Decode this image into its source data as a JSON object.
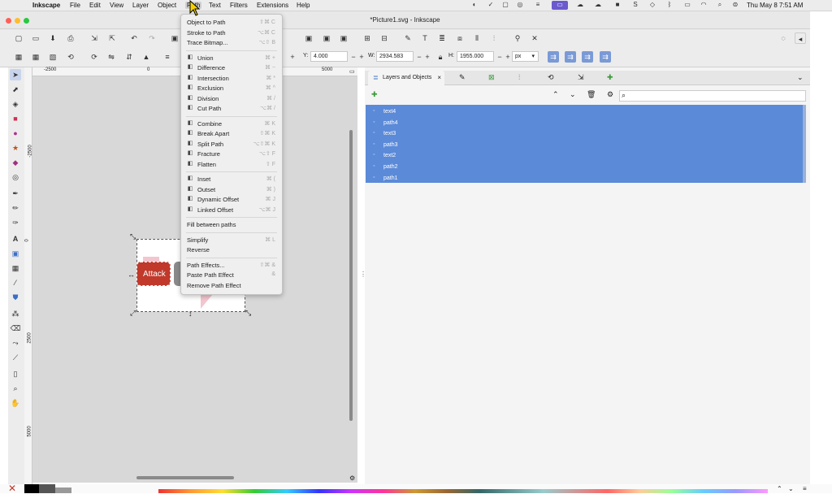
{
  "system_menubar": {
    "app": "Inkscape",
    "menus": [
      "File",
      "Edit",
      "View",
      "Layer",
      "Object",
      "Path",
      "Text",
      "Filters",
      "Extensions",
      "Help"
    ],
    "clock": "Thu May 8  7:51 AM"
  },
  "window": {
    "title": "*Picture1.svg - Inkscape"
  },
  "toolbar2": {
    "y_label": "Y:",
    "y_value": "4.000",
    "w_label": "W:",
    "w_value": "2934.583",
    "h_label": "H:",
    "h_value": "1955.000",
    "unit": "px"
  },
  "rulers": {
    "top": [
      "-2500",
      "0",
      "5000"
    ],
    "left": [
      "-2500",
      "0",
      "2500",
      "5000"
    ]
  },
  "canvas": {
    "button_text": "Attack"
  },
  "path_menu": {
    "groups": [
      [
        {
          "label": "Object to Path",
          "shortcut": "⇧⌘ C",
          "icon": ""
        },
        {
          "label": "Stroke to Path",
          "shortcut": "⌥⌘ C",
          "icon": ""
        },
        {
          "label": "Trace Bitmap...",
          "shortcut": "⌥⇧ B",
          "icon": ""
        }
      ],
      [
        {
          "label": "Union",
          "shortcut": "⌘ +",
          "icon": "union-icon"
        },
        {
          "label": "Difference",
          "shortcut": "⌘ −",
          "icon": "difference-icon"
        },
        {
          "label": "Intersection",
          "shortcut": "⌘ *",
          "icon": "intersection-icon"
        },
        {
          "label": "Exclusion",
          "shortcut": "⌘ ^",
          "icon": "exclusion-icon"
        },
        {
          "label": "Division",
          "shortcut": "⌘ /",
          "icon": "division-icon"
        },
        {
          "label": "Cut Path",
          "shortcut": "⌥⌘ /",
          "icon": "cut-path-icon"
        }
      ],
      [
        {
          "label": "Combine",
          "shortcut": "⌘ K",
          "icon": "combine-icon"
        },
        {
          "label": "Break Apart",
          "shortcut": "⇧⌘ K",
          "icon": "break-apart-icon"
        },
        {
          "label": "Split Path",
          "shortcut": "⌥⇧⌘ K",
          "icon": "split-path-icon"
        },
        {
          "label": "Fracture",
          "shortcut": "⌥⇧ F",
          "icon": "fracture-icon"
        },
        {
          "label": "Flatten",
          "shortcut": "⇧ F",
          "icon": "flatten-icon"
        }
      ],
      [
        {
          "label": "Inset",
          "shortcut": "⌘ (",
          "icon": "inset-icon"
        },
        {
          "label": "Outset",
          "shortcut": "⌘ )",
          "icon": "outset-icon"
        },
        {
          "label": "Dynamic Offset",
          "shortcut": "⌘ J",
          "icon": "dynamic-offset-icon"
        },
        {
          "label": "Linked Offset",
          "shortcut": "⌥⌘ J",
          "icon": "linked-offset-icon"
        }
      ],
      [
        {
          "label": "Fill between paths",
          "shortcut": "",
          "icon": ""
        }
      ],
      [
        {
          "label": "Simplify",
          "shortcut": "⌘ L",
          "icon": ""
        },
        {
          "label": "Reverse",
          "shortcut": "",
          "icon": ""
        }
      ],
      [
        {
          "label": "Path Effects...",
          "shortcut": "⇧⌘ &",
          "icon": ""
        },
        {
          "label": "Paste Path Effect",
          "shortcut": "&",
          "icon": ""
        },
        {
          "label": "Remove Path Effect",
          "shortcut": "",
          "icon": ""
        }
      ]
    ]
  },
  "dock": {
    "active_tab": "Layers and Objects",
    "objects": [
      "text4",
      "path4",
      "text3",
      "path3",
      "text2",
      "path2",
      "path1"
    ]
  },
  "colors": {
    "selection": "#5b8ad8",
    "attack_button": "#c0392b",
    "menu_bg": "#efefef"
  }
}
